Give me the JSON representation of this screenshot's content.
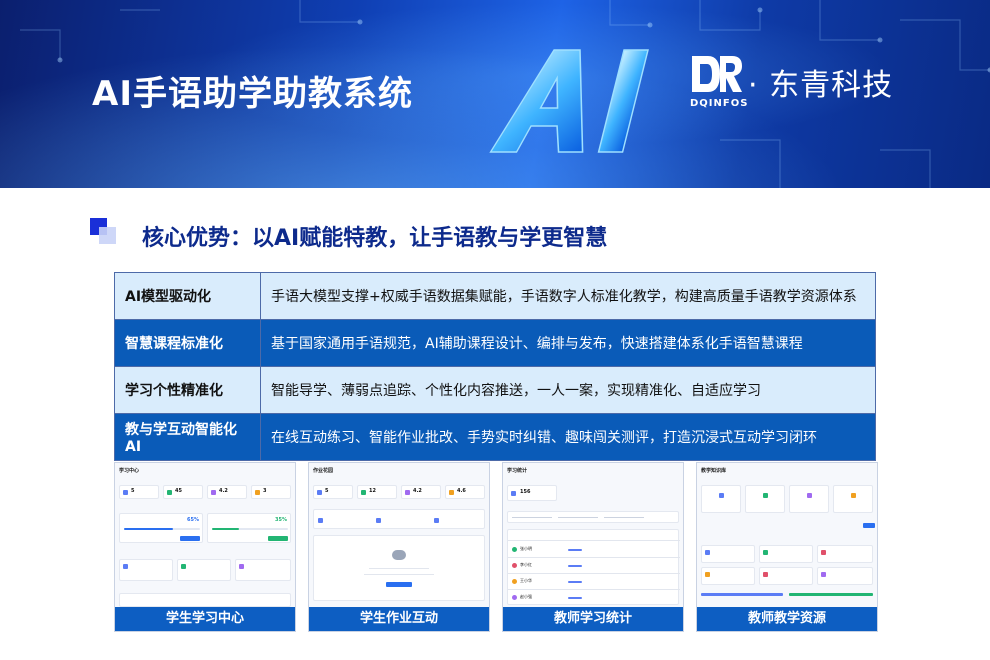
{
  "banner": {
    "title": "AI手语助学助教系统",
    "ai_graphic_text": "AI",
    "brand": {
      "logo_letters": "DQ",
      "logo_sub": "DQINFOS",
      "name": "· 东青科技"
    }
  },
  "section": {
    "title": "核心优势：以AI赋能特教，让手语教与学更智慧"
  },
  "advantages": [
    {
      "key": "AI模型驱动化",
      "value": "手语大模型支撑+权威手语数据集赋能，手语数字人标准化教学，构建高质量手语教学资源体系",
      "style": "light"
    },
    {
      "key": "智慧课程标准化",
      "value": "基于国家通用手语规范，AI辅助课程设计、编排与发布，快速搭建体系化手语智慧课程",
      "style": "dark"
    },
    {
      "key": "学习个性精准化",
      "value": "智能导学、薄弱点追踪、个性化内容推送，一人一案，实现精准化、自适应学习",
      "style": "light"
    },
    {
      "key": "教与学互动智能化AI",
      "value": "在线互动练习、智能作业批改、手势实时纠错、趣味闯关测评，打造沉浸式互动学习闭环",
      "style": "dark"
    }
  ],
  "screenshots": [
    {
      "caption": "学生学习中心",
      "title": "学习中心",
      "stats": [
        "5",
        "45",
        "4.2",
        "3"
      ],
      "pct_a": "65%",
      "pct_b": "35%"
    },
    {
      "caption": "学生作业互动",
      "title": "作业花园",
      "stats": [
        "5",
        "12",
        "4.2",
        "4.6"
      ]
    },
    {
      "caption": "教师学习统计",
      "title": "学习统计",
      "stats": [
        "156"
      ],
      "rows": [
        "张小明",
        "李小红",
        "王小华",
        "赵小强"
      ]
    },
    {
      "caption": "教师教学资源",
      "title": "教学知识库"
    }
  ],
  "colors": {
    "banner_dark": "#0b1f6e",
    "table_dark": "#0a5bb8",
    "table_light": "#d9ecfc",
    "caption_bg": "#0d5ec2",
    "title_blue": "#0d2a8c"
  }
}
